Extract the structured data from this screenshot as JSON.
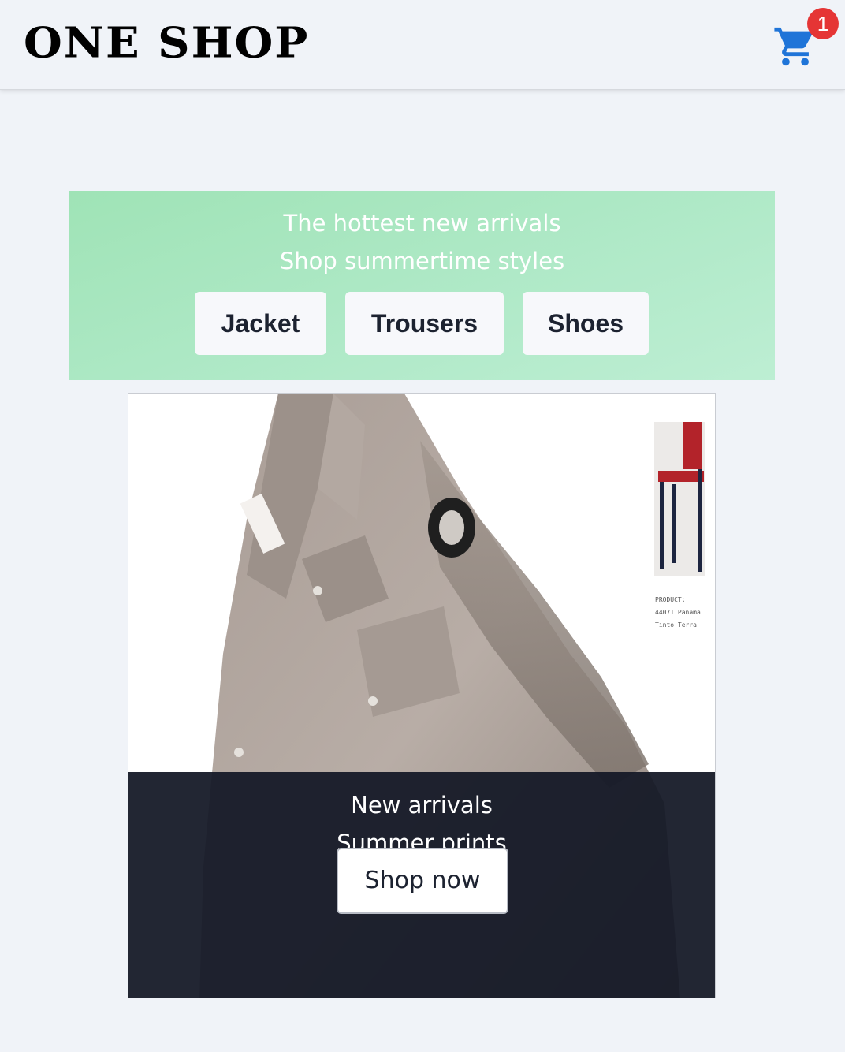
{
  "header": {
    "logo_text": "ONE SHOP",
    "cart_icon": "shopping-cart-icon",
    "cart_count": "1",
    "accent_color": "#1f74d8",
    "badge_color": "#e53535"
  },
  "promo": {
    "line1": "The hottest new arrivals",
    "line2": "Shop summertime styles",
    "categories": [
      "Jacket",
      "Trousers",
      "Shoes"
    ],
    "background_color": "#a8e6c0"
  },
  "hero": {
    "image_subject": "beige utility jacket with chair photo",
    "caption": {
      "line1": "New arrivals",
      "line2": "Summer prints"
    },
    "cta_label": "Shop now",
    "product_text": [
      "PRODUCT",
      "44071 Panama",
      "Tinto Terra"
    ]
  }
}
